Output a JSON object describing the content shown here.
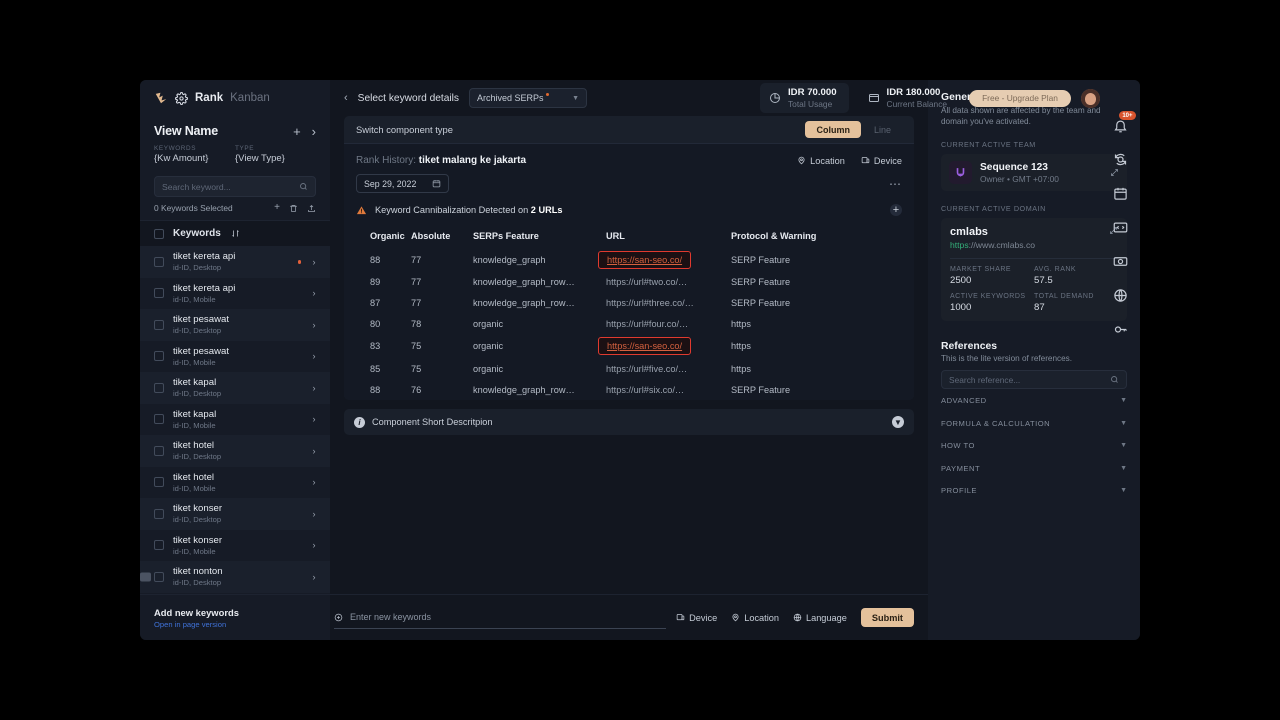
{
  "brand": {
    "rank": "Rank",
    "kanban": "Kanban",
    "logo_icon": "logo-mark-icon",
    "gear_icon": "gear-icon"
  },
  "topbar": {
    "usage": {
      "value": "IDR 70.000",
      "label": "Total Usage",
      "icon": "pie-chart-icon"
    },
    "balance": {
      "value": "IDR 180.000",
      "label": "Current Balance",
      "icon": "wallet-icon"
    },
    "upgrade_label": "Free - Upgrade Plan",
    "avatar": "user-avatar"
  },
  "sidebar": {
    "view_name": "View Name",
    "add_icon": "plus-icon",
    "expand_icon": "chevron-right-icon",
    "meta": [
      {
        "label": "KEYWORDS",
        "value": "{Kw Amount}"
      },
      {
        "label": "TYPE",
        "value": "{View Type}"
      }
    ],
    "search_placeholder": "Search keyword...",
    "search_value": "",
    "selected_text": "0 Keywords Selected",
    "row_actions": [
      "plus-icon",
      "trash-icon",
      "share-icon"
    ],
    "list_header": "Keywords",
    "sort_icon": "sort-icon",
    "keywords": [
      {
        "name": "tiket kereta api",
        "sub": "id-ID, Desktop",
        "dot": true
      },
      {
        "name": "tiket kereta api",
        "sub": "id-ID, Mobile",
        "dot": false
      },
      {
        "name": "tiket pesawat",
        "sub": "id-ID, Desktop",
        "dot": false
      },
      {
        "name": "tiket pesawat",
        "sub": "id-ID, Mobile",
        "dot": false
      },
      {
        "name": "tiket kapal",
        "sub": "id-ID, Desktop",
        "dot": false
      },
      {
        "name": "tiket kapal",
        "sub": "id-ID, Mobile",
        "dot": false
      },
      {
        "name": "tiket hotel",
        "sub": "id-ID, Desktop",
        "dot": false
      },
      {
        "name": "tiket hotel",
        "sub": "id-ID, Mobile",
        "dot": false
      },
      {
        "name": "tiket konser",
        "sub": "id-ID, Desktop",
        "dot": false
      },
      {
        "name": "tiket konser",
        "sub": "id-ID, Mobile",
        "dot": false
      },
      {
        "name": "tiket nonton",
        "sub": "id-ID, Desktop",
        "dot": false
      }
    ],
    "add_title": "Add new keywords",
    "add_link": "Open in page version"
  },
  "center": {
    "back_label": "Select keyword details",
    "serp_select": "Archived SERPs",
    "switch_label": "Switch component type",
    "segments": [
      {
        "label": "Column",
        "active": true
      },
      {
        "label": "Line",
        "active": false
      }
    ],
    "rank_history_prefix": "Rank History:",
    "rank_history_keyword": "tiket malang ke jakarta",
    "chips": [
      {
        "label": "Location",
        "icon": "location-pin-icon"
      },
      {
        "label": "Device",
        "icon": "device-icon"
      }
    ],
    "date_value": "Sep 29, 2022",
    "date_icon": "calendar-icon",
    "more_icon": "more-dots-icon",
    "cannibalization": {
      "icon": "warning-triangle-icon",
      "text_before": "Keyword Cannibalization Detected on",
      "count": "2 URLs",
      "add_icon": "plus-circle-icon"
    },
    "description_bar": {
      "info_icon": "info-icon",
      "text": "Component Short Descritpion",
      "toggle_icon": "chevron-down-circle-icon"
    },
    "bottom": {
      "new_keyword_placeholder": "Enter new keywords",
      "new_keyword_value": "",
      "add_icon": "plus-circle-icon",
      "actions": [
        {
          "label": "Device",
          "icon": "device-icon"
        },
        {
          "label": "Location",
          "icon": "location-pin-icon"
        },
        {
          "label": "Language",
          "icon": "globe-icon"
        }
      ],
      "submit_label": "Submit"
    }
  },
  "chart_data": {
    "type": "table",
    "title": "Rank History: tiket malang ke jakarta",
    "columns": [
      "Organic",
      "Absolute",
      "SERPs Feature",
      "URL",
      "Protocol & Warning"
    ],
    "rows": [
      {
        "organic": "88",
        "absolute": "77",
        "serps_feature": "knowledge_graph",
        "url": "https://san-seo.co/",
        "flagged": true,
        "protocol": "SERP Feature"
      },
      {
        "organic": "89",
        "absolute": "77",
        "serps_feature": "knowledge_graph_row…",
        "url": "https://url#two.co/…",
        "flagged": false,
        "protocol": "SERP Feature"
      },
      {
        "organic": "87",
        "absolute": "77",
        "serps_feature": "knowledge_graph_row…",
        "url": "https://url#three.co/…",
        "flagged": false,
        "protocol": "SERP Feature"
      },
      {
        "organic": "80",
        "absolute": "78",
        "serps_feature": "organic",
        "url": "https://url#four.co/…",
        "flagged": false,
        "protocol": "https"
      },
      {
        "organic": "83",
        "absolute": "75",
        "serps_feature": "organic",
        "url": "https://san-seo.co/",
        "flagged": true,
        "protocol": "https"
      },
      {
        "organic": "85",
        "absolute": "75",
        "serps_feature": "organic",
        "url": "https://url#five.co/…",
        "flagged": false,
        "protocol": "https"
      },
      {
        "organic": "88",
        "absolute": "76",
        "serps_feature": "knowledge_graph_row…",
        "url": "https://url#six.co/…",
        "flagged": false,
        "protocol": "SERP Feature"
      }
    ],
    "flag_color": "#e03a2f",
    "accent_color": "#e4c19b"
  },
  "right": {
    "heading": "General Data Basis",
    "sub": "All data shown are affected by the team and domain you've activated.",
    "team_caption": "CURRENT ACTIVE TEAM",
    "team_name": "Sequence 123",
    "team_meta": "Owner • GMT +07:00",
    "domain_caption": "CURRENT ACTIVE DOMAIN",
    "domain_name": "cmlabs",
    "domain_url_scheme": "https",
    "domain_url_rest": "://www.cmlabs.co",
    "stats": [
      {
        "label": "MARKET SHARE",
        "value": "2500"
      },
      {
        "label": "AVG. RANK",
        "value": "57.5"
      },
      {
        "label": "ACTIVE KEYWORDS",
        "value": "1000"
      },
      {
        "label": "TOTAL DEMAND",
        "value": "87"
      }
    ],
    "references_heading": "References",
    "references_sub": "This is the lite version of references.",
    "references_search_placeholder": "Search reference...",
    "references_search_value": "",
    "accordions": [
      "ADVANCED",
      "FORMULA & CALCULATION",
      "HOW TO",
      "PAYMENT",
      "PROFILE"
    ]
  },
  "rail": {
    "notification_badge": "10+",
    "icons": [
      "bell-icon",
      "sync-icon",
      "calendar-icon",
      "code-icon",
      "camera-icon",
      "globe-icon",
      "key-icon"
    ]
  }
}
